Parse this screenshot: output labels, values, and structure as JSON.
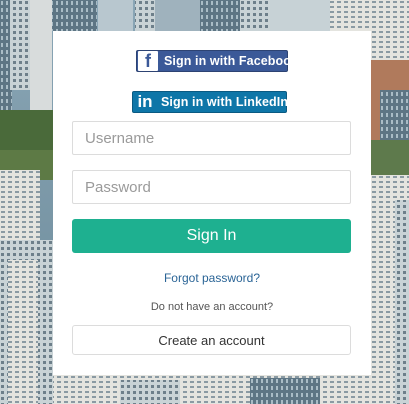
{
  "social": {
    "facebook_label": "Sign in with Facebook",
    "facebook_icon": "facebook-f-icon",
    "facebook_color": "#3b5998",
    "linkedin_label": "Sign in with LinkedIn",
    "linkedin_icon": "linkedin-in-icon",
    "linkedin_color": "#0e76a8"
  },
  "form": {
    "username_placeholder": "Username",
    "username_value": "",
    "password_placeholder": "Password",
    "password_value": "",
    "signin_label": "Sign In",
    "signin_color": "#1eb090"
  },
  "links": {
    "forgot_password": "Forgot password?",
    "no_account_text": "Do not have an account?",
    "create_account": "Create an account"
  }
}
